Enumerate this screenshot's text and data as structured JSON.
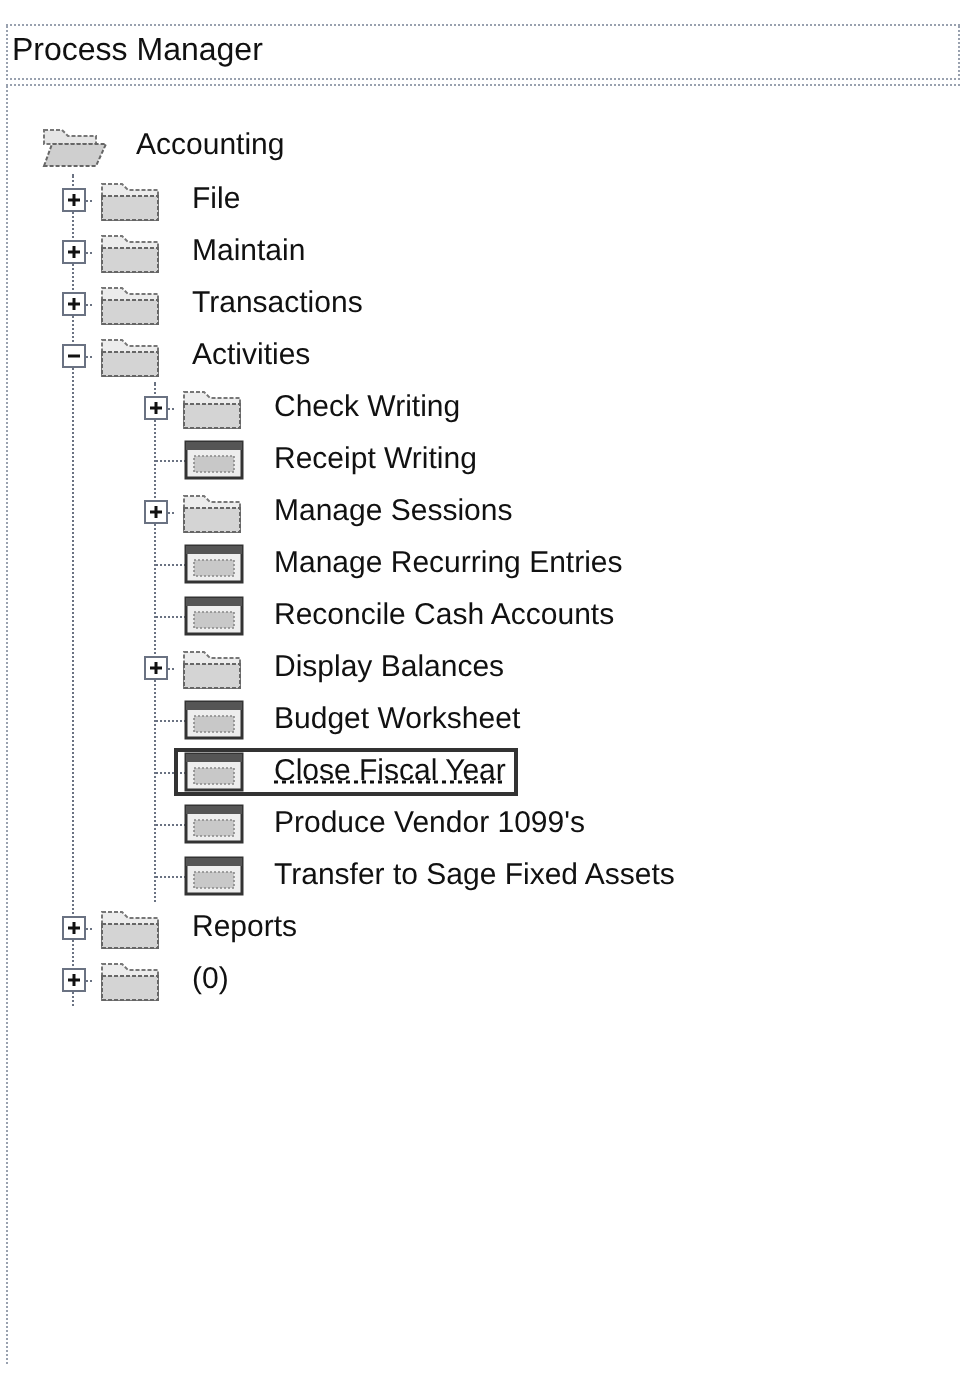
{
  "title_bar": {
    "title": "Process Manager"
  },
  "tree": [
    {
      "label": "Accounting",
      "kind": "folder",
      "expanded": true,
      "selected": false,
      "children": [
        {
          "label": "File",
          "kind": "folder",
          "expanded": false,
          "selected": false
        },
        {
          "label": "Maintain",
          "kind": "folder",
          "expanded": false,
          "selected": false
        },
        {
          "label": "Transactions",
          "kind": "folder",
          "expanded": false,
          "selected": false
        },
        {
          "label": "Activities",
          "kind": "folder",
          "expanded": true,
          "selected": false,
          "children": [
            {
              "label": "Check Writing",
              "kind": "folder",
              "expanded": false,
              "selected": false
            },
            {
              "label": "Receipt Writing",
              "kind": "task",
              "selected": false
            },
            {
              "label": "Manage Sessions",
              "kind": "folder",
              "expanded": false,
              "selected": false
            },
            {
              "label": "Manage Recurring Entries",
              "kind": "task",
              "selected": false
            },
            {
              "label": "Reconcile Cash Accounts",
              "kind": "task",
              "selected": false
            },
            {
              "label": "Display Balances",
              "kind": "folder",
              "expanded": false,
              "selected": false
            },
            {
              "label": "Budget Worksheet",
              "kind": "task",
              "selected": false
            },
            {
              "label": "Close Fiscal Year",
              "kind": "task",
              "selected": true
            },
            {
              "label": "Produce Vendor 1099's",
              "kind": "task",
              "selected": false
            },
            {
              "label": "Transfer to Sage Fixed Assets",
              "kind": "task",
              "selected": false
            }
          ]
        },
        {
          "label": "Reports",
          "kind": "folder",
          "expanded": false,
          "selected": false
        },
        {
          "label": "(0)",
          "kind": "folder",
          "expanded": false,
          "selected": false
        }
      ]
    }
  ]
}
